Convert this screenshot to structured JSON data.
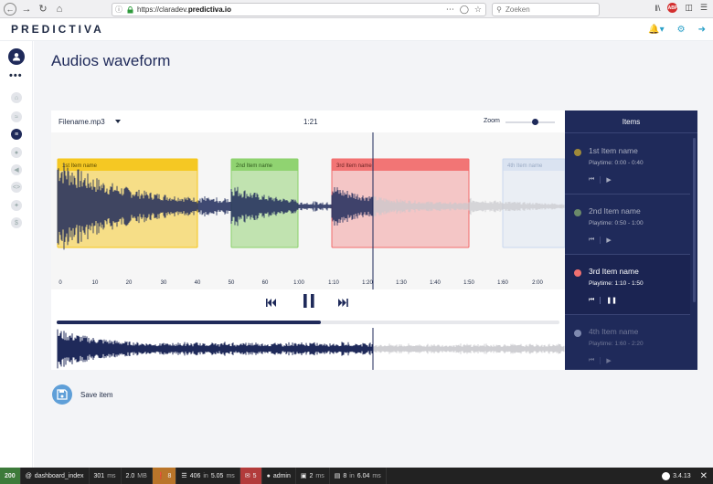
{
  "browser": {
    "url_prefix": "https://claradev.",
    "url_domain": "predictiva.io",
    "search_placeholder": "Zoeken"
  },
  "app": {
    "logo": "PREDICTIVA",
    "page_title": "Audios waveform"
  },
  "player": {
    "filename": "Filename.mp3",
    "current_time": "1:21",
    "zoom_label": "Zoom",
    "zoom_level": 0.6,
    "progress": 0.525,
    "timeline_ticks": [
      "0",
      "10",
      "20",
      "30",
      "40",
      "50",
      "60",
      "1:00",
      "1:10",
      "1:20",
      "1:30",
      "1:40",
      "1:50",
      "1:60",
      "2:00"
    ]
  },
  "regions": [
    {
      "label": "1st Item name",
      "color": "#f5c518"
    },
    {
      "label": "2nd Item name",
      "color": "#8bd06a"
    },
    {
      "label": "3rd Item name",
      "color": "#f26c6c"
    },
    {
      "label": "4th Item name",
      "color": "#c9d8ee"
    }
  ],
  "items_panel": {
    "title": "Items",
    "items": [
      {
        "name": "1st Item name",
        "playtime": "Playtime: 0:00 - 0:40",
        "dot_color": "#a08a3a"
      },
      {
        "name": "2nd Item name",
        "playtime": "Playtime: 0:50 - 1:00",
        "dot_color": "#6b8a6a"
      },
      {
        "name": "3rd Item name",
        "playtime": "Playtime: 1:10 - 1:50",
        "dot_color": "#f07070"
      },
      {
        "name": "4th Item name",
        "playtime": "Playtime: 1:60 - 2:20",
        "dot_color": "#7f8ab0"
      }
    ]
  },
  "save": {
    "label": "Save item"
  },
  "debug": {
    "status": "200",
    "route": "dashboard_index",
    "time_ms": "301",
    "time_unit": "ms",
    "memory": "2.0",
    "memory_unit": "MB",
    "warnings": "8",
    "cache_calls": "406",
    "cache_in": "in",
    "cache_time": "5.05",
    "cache_unit": "ms",
    "errors": "5",
    "user": "admin",
    "render_ms": "2",
    "render_unit": "ms",
    "db_queries": "8",
    "db_in": "in",
    "db_time": "6.04",
    "db_unit": "ms",
    "version": "3.4.13"
  },
  "icons": {
    "user": "user-icon",
    "bell": "bell-icon",
    "gear": "gear-icon",
    "logout": "logout-icon",
    "save": "floppy-icon"
  }
}
